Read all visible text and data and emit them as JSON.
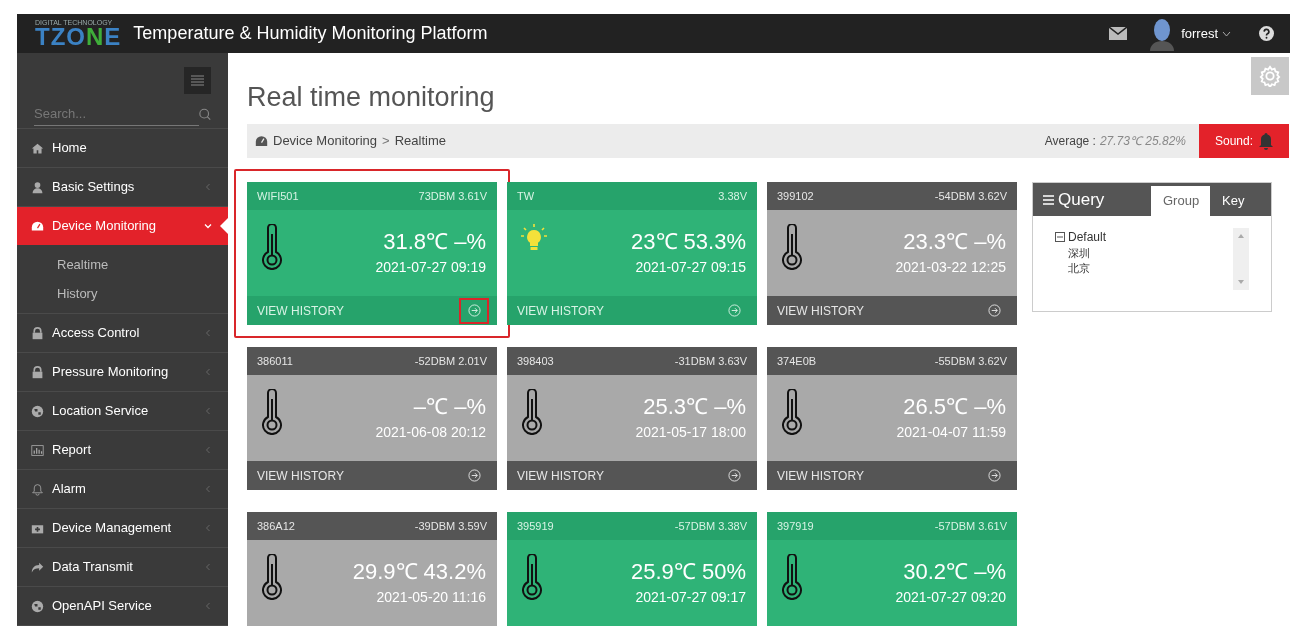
{
  "header": {
    "logo": {
      "tagline": "DIGITAL TECHNOLOGY",
      "parts": [
        {
          "text": "TZO",
          "color": "#3b82c4"
        },
        {
          "text": "N",
          "color": "#3fae3a"
        },
        {
          "text": "E",
          "color": "#3b82c4"
        }
      ]
    },
    "title": "Temperature & Humidity Monitoring Platform",
    "user": "forrest"
  },
  "sidebar": {
    "search": {
      "placeholder": "Search..."
    },
    "items": [
      {
        "label": "Home",
        "kind": "home",
        "selected": false
      },
      {
        "label": "Basic Settings",
        "kind": "user",
        "selected": false,
        "expanded": false
      },
      {
        "label": "Device Monitoring",
        "kind": "gauge",
        "selected": true,
        "expanded": true,
        "children": [
          {
            "label": "Realtime"
          },
          {
            "label": "History"
          }
        ]
      },
      {
        "label": "Access Control",
        "kind": "lock",
        "selected": false,
        "expanded": false
      },
      {
        "label": "Pressure Monitoring",
        "kind": "lock",
        "selected": false,
        "expanded": false
      },
      {
        "label": "Location Service",
        "kind": "globe",
        "selected": false,
        "expanded": false
      },
      {
        "label": "Report",
        "kind": "chart",
        "selected": false,
        "expanded": false
      },
      {
        "label": "Alarm",
        "kind": "bell",
        "selected": false,
        "expanded": false
      },
      {
        "label": "Device Management",
        "kind": "kit",
        "selected": false,
        "expanded": false
      },
      {
        "label": "Data Transmit",
        "kind": "share",
        "selected": false,
        "expanded": false
      },
      {
        "label": "OpenAPI Service",
        "kind": "globe",
        "selected": false,
        "expanded": false
      }
    ]
  },
  "page": {
    "title": "Real time monitoring",
    "breadcrumb": [
      "Device Monitoring",
      "Realtime"
    ],
    "breadcrumb_separator": ">",
    "average_label": "Average :",
    "average_value": "27.73℃ 25.82%",
    "sound_label": "Sound:"
  },
  "cards": [
    {
      "id": "WIFI501",
      "signal": "73DBM 3.61V",
      "reading": "31.8℃ –%",
      "time": "2021-07-27 09:19",
      "online": true,
      "kind": "thermometer",
      "footer": "VIEW HISTORY",
      "highlighted": true
    },
    {
      "id": "TW",
      "signal": "3.38V",
      "reading": "23℃ 53.3%",
      "time": "2021-07-27 09:15",
      "online": true,
      "kind": "bulb",
      "footer": "VIEW HISTORY",
      "highlighted": false
    },
    {
      "id": "399102",
      "signal": "-54DBM 3.62V",
      "reading": "23.3℃ –%",
      "time": "2021-03-22 12:25",
      "online": false,
      "kind": "thermometer",
      "footer": "VIEW HISTORY",
      "highlighted": false
    },
    {
      "id": "386011",
      "signal": "-52DBM 2.01V",
      "reading": "–℃ –%",
      "time": "2021-06-08 20:12",
      "online": false,
      "kind": "thermometer",
      "footer": "VIEW HISTORY",
      "highlighted": false
    },
    {
      "id": "398403",
      "signal": "-31DBM 3.63V",
      "reading": "25.3℃ –%",
      "time": "2021-05-17 18:00",
      "online": false,
      "kind": "thermometer",
      "footer": "VIEW HISTORY",
      "highlighted": false
    },
    {
      "id": "374E0B",
      "signal": "-55DBM 3.62V",
      "reading": "26.5℃ –%",
      "time": "2021-04-07 11:59",
      "online": false,
      "kind": "thermometer",
      "footer": "VIEW HISTORY",
      "highlighted": false
    },
    {
      "id": "386A12",
      "signal": "-39DBM 3.59V",
      "reading": "29.9℃ 43.2%",
      "time": "2021-05-20 11:16",
      "online": false,
      "kind": "thermometer",
      "highlighted": false
    },
    {
      "id": "395919",
      "signal": "-57DBM 3.38V",
      "reading": "25.9℃ 50%",
      "time": "2021-07-27 09:17",
      "online": true,
      "kind": "thermometer",
      "highlighted": false
    },
    {
      "id": "397919",
      "signal": "-57DBM 3.61V",
      "reading": "30.2℃ –%",
      "time": "2021-07-27 09:20",
      "online": true,
      "kind": "thermometer",
      "highlighted": false
    }
  ],
  "query": {
    "title": "Query",
    "tabs": [
      {
        "label": "Group",
        "selected": true
      },
      {
        "label": "Key",
        "selected": false
      }
    ],
    "tree": [
      {
        "label": "Default",
        "expanded": true,
        "children": [
          {
            "label": "深圳"
          },
          {
            "label": "北京"
          }
        ]
      }
    ]
  }
}
